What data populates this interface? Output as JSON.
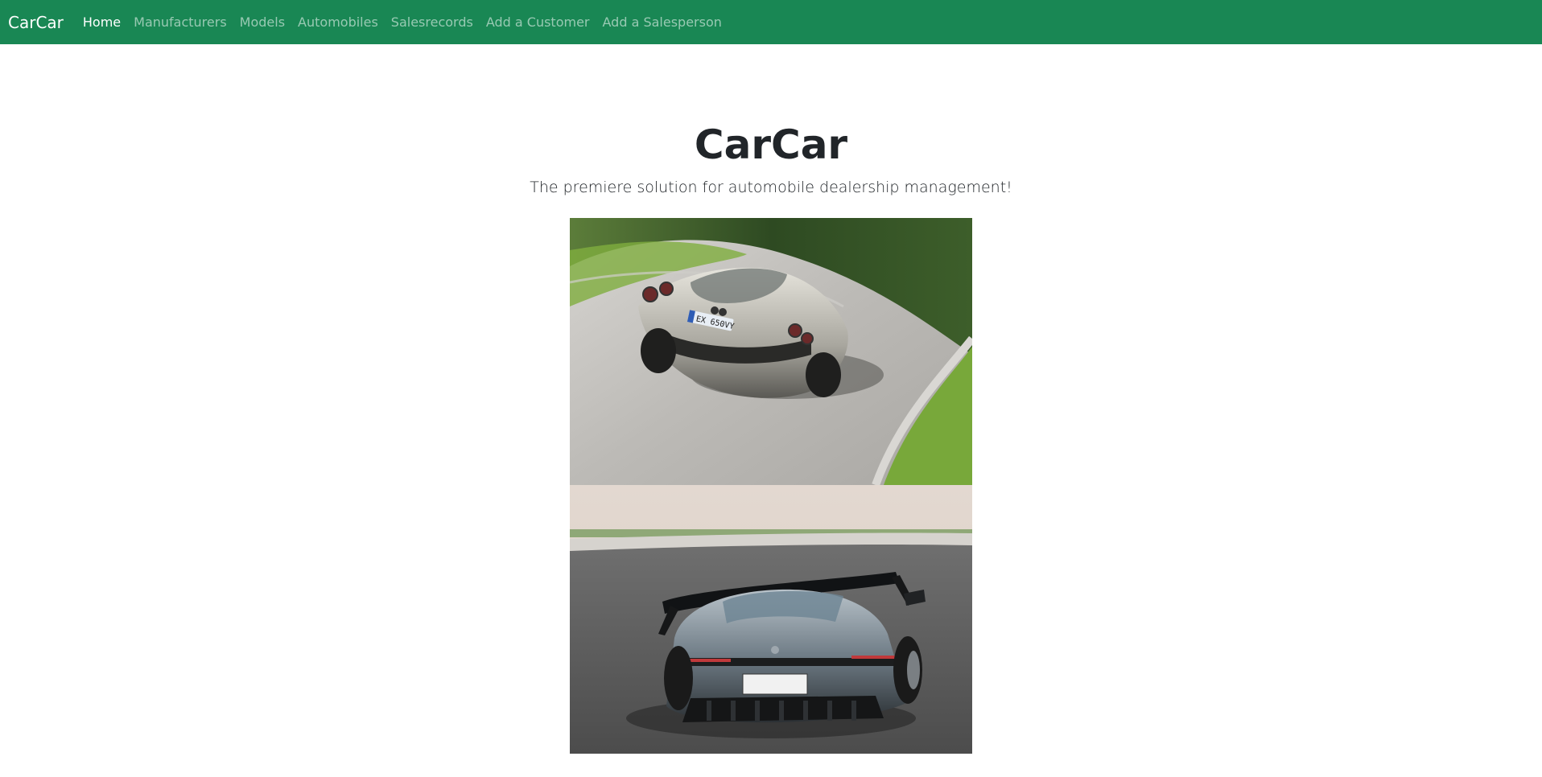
{
  "navbar": {
    "brand": "CarCar",
    "links": [
      {
        "label": "Home",
        "active": true
      },
      {
        "label": "Manufacturers",
        "active": false
      },
      {
        "label": "Models",
        "active": false
      },
      {
        "label": "Automobiles",
        "active": false
      },
      {
        "label": "Salesrecords",
        "active": false
      },
      {
        "label": "Add a Customer",
        "active": false
      },
      {
        "label": "Add a Salesperson",
        "active": false
      }
    ]
  },
  "hero": {
    "title": "CarCar",
    "lead": "The premiere solution for automobile dealership management!"
  },
  "photos": {
    "plate_1": "EX 650VY"
  },
  "colors": {
    "navbar_bg": "#198754",
    "nav_active": "#ffffff",
    "nav_inactive": "rgba(255,255,255,0.55)"
  }
}
